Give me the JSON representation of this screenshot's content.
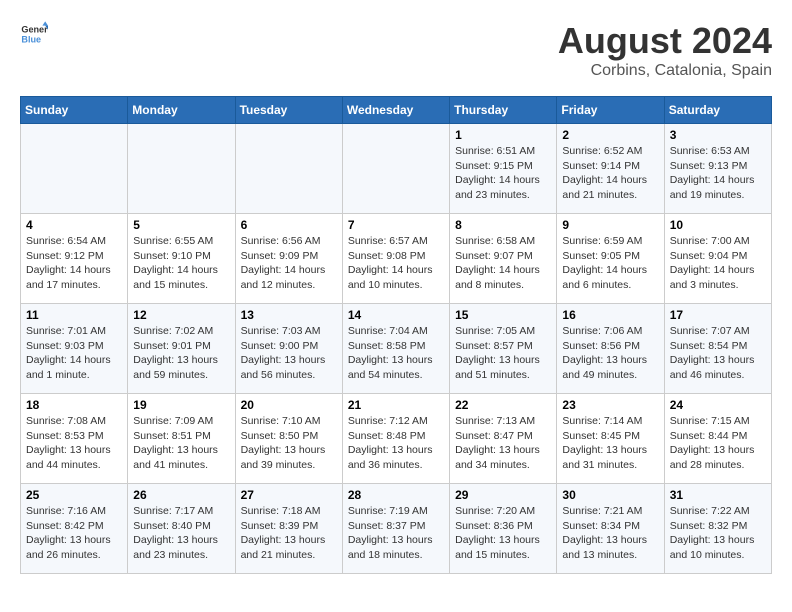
{
  "logo": {
    "text_general": "General",
    "text_blue": "Blue"
  },
  "title": "August 2024",
  "subtitle": "Corbins, Catalonia, Spain",
  "days_of_week": [
    "Sunday",
    "Monday",
    "Tuesday",
    "Wednesday",
    "Thursday",
    "Friday",
    "Saturday"
  ],
  "weeks": [
    [
      {
        "day": "",
        "info": ""
      },
      {
        "day": "",
        "info": ""
      },
      {
        "day": "",
        "info": ""
      },
      {
        "day": "",
        "info": ""
      },
      {
        "day": "1",
        "info": "Sunrise: 6:51 AM\nSunset: 9:15 PM\nDaylight: 14 hours\nand 23 minutes."
      },
      {
        "day": "2",
        "info": "Sunrise: 6:52 AM\nSunset: 9:14 PM\nDaylight: 14 hours\nand 21 minutes."
      },
      {
        "day": "3",
        "info": "Sunrise: 6:53 AM\nSunset: 9:13 PM\nDaylight: 14 hours\nand 19 minutes."
      }
    ],
    [
      {
        "day": "4",
        "info": "Sunrise: 6:54 AM\nSunset: 9:12 PM\nDaylight: 14 hours\nand 17 minutes."
      },
      {
        "day": "5",
        "info": "Sunrise: 6:55 AM\nSunset: 9:10 PM\nDaylight: 14 hours\nand 15 minutes."
      },
      {
        "day": "6",
        "info": "Sunrise: 6:56 AM\nSunset: 9:09 PM\nDaylight: 14 hours\nand 12 minutes."
      },
      {
        "day": "7",
        "info": "Sunrise: 6:57 AM\nSunset: 9:08 PM\nDaylight: 14 hours\nand 10 minutes."
      },
      {
        "day": "8",
        "info": "Sunrise: 6:58 AM\nSunset: 9:07 PM\nDaylight: 14 hours\nand 8 minutes."
      },
      {
        "day": "9",
        "info": "Sunrise: 6:59 AM\nSunset: 9:05 PM\nDaylight: 14 hours\nand 6 minutes."
      },
      {
        "day": "10",
        "info": "Sunrise: 7:00 AM\nSunset: 9:04 PM\nDaylight: 14 hours\nand 3 minutes."
      }
    ],
    [
      {
        "day": "11",
        "info": "Sunrise: 7:01 AM\nSunset: 9:03 PM\nDaylight: 14 hours\nand 1 minute."
      },
      {
        "day": "12",
        "info": "Sunrise: 7:02 AM\nSunset: 9:01 PM\nDaylight: 13 hours\nand 59 minutes."
      },
      {
        "day": "13",
        "info": "Sunrise: 7:03 AM\nSunset: 9:00 PM\nDaylight: 13 hours\nand 56 minutes."
      },
      {
        "day": "14",
        "info": "Sunrise: 7:04 AM\nSunset: 8:58 PM\nDaylight: 13 hours\nand 54 minutes."
      },
      {
        "day": "15",
        "info": "Sunrise: 7:05 AM\nSunset: 8:57 PM\nDaylight: 13 hours\nand 51 minutes."
      },
      {
        "day": "16",
        "info": "Sunrise: 7:06 AM\nSunset: 8:56 PM\nDaylight: 13 hours\nand 49 minutes."
      },
      {
        "day": "17",
        "info": "Sunrise: 7:07 AM\nSunset: 8:54 PM\nDaylight: 13 hours\nand 46 minutes."
      }
    ],
    [
      {
        "day": "18",
        "info": "Sunrise: 7:08 AM\nSunset: 8:53 PM\nDaylight: 13 hours\nand 44 minutes."
      },
      {
        "day": "19",
        "info": "Sunrise: 7:09 AM\nSunset: 8:51 PM\nDaylight: 13 hours\nand 41 minutes."
      },
      {
        "day": "20",
        "info": "Sunrise: 7:10 AM\nSunset: 8:50 PM\nDaylight: 13 hours\nand 39 minutes."
      },
      {
        "day": "21",
        "info": "Sunrise: 7:12 AM\nSunset: 8:48 PM\nDaylight: 13 hours\nand 36 minutes."
      },
      {
        "day": "22",
        "info": "Sunrise: 7:13 AM\nSunset: 8:47 PM\nDaylight: 13 hours\nand 34 minutes."
      },
      {
        "day": "23",
        "info": "Sunrise: 7:14 AM\nSunset: 8:45 PM\nDaylight: 13 hours\nand 31 minutes."
      },
      {
        "day": "24",
        "info": "Sunrise: 7:15 AM\nSunset: 8:44 PM\nDaylight: 13 hours\nand 28 minutes."
      }
    ],
    [
      {
        "day": "25",
        "info": "Sunrise: 7:16 AM\nSunset: 8:42 PM\nDaylight: 13 hours\nand 26 minutes."
      },
      {
        "day": "26",
        "info": "Sunrise: 7:17 AM\nSunset: 8:40 PM\nDaylight: 13 hours\nand 23 minutes."
      },
      {
        "day": "27",
        "info": "Sunrise: 7:18 AM\nSunset: 8:39 PM\nDaylight: 13 hours\nand 21 minutes."
      },
      {
        "day": "28",
        "info": "Sunrise: 7:19 AM\nSunset: 8:37 PM\nDaylight: 13 hours\nand 18 minutes."
      },
      {
        "day": "29",
        "info": "Sunrise: 7:20 AM\nSunset: 8:36 PM\nDaylight: 13 hours\nand 15 minutes."
      },
      {
        "day": "30",
        "info": "Sunrise: 7:21 AM\nSunset: 8:34 PM\nDaylight: 13 hours\nand 13 minutes."
      },
      {
        "day": "31",
        "info": "Sunrise: 7:22 AM\nSunset: 8:32 PM\nDaylight: 13 hours\nand 10 minutes."
      }
    ]
  ]
}
